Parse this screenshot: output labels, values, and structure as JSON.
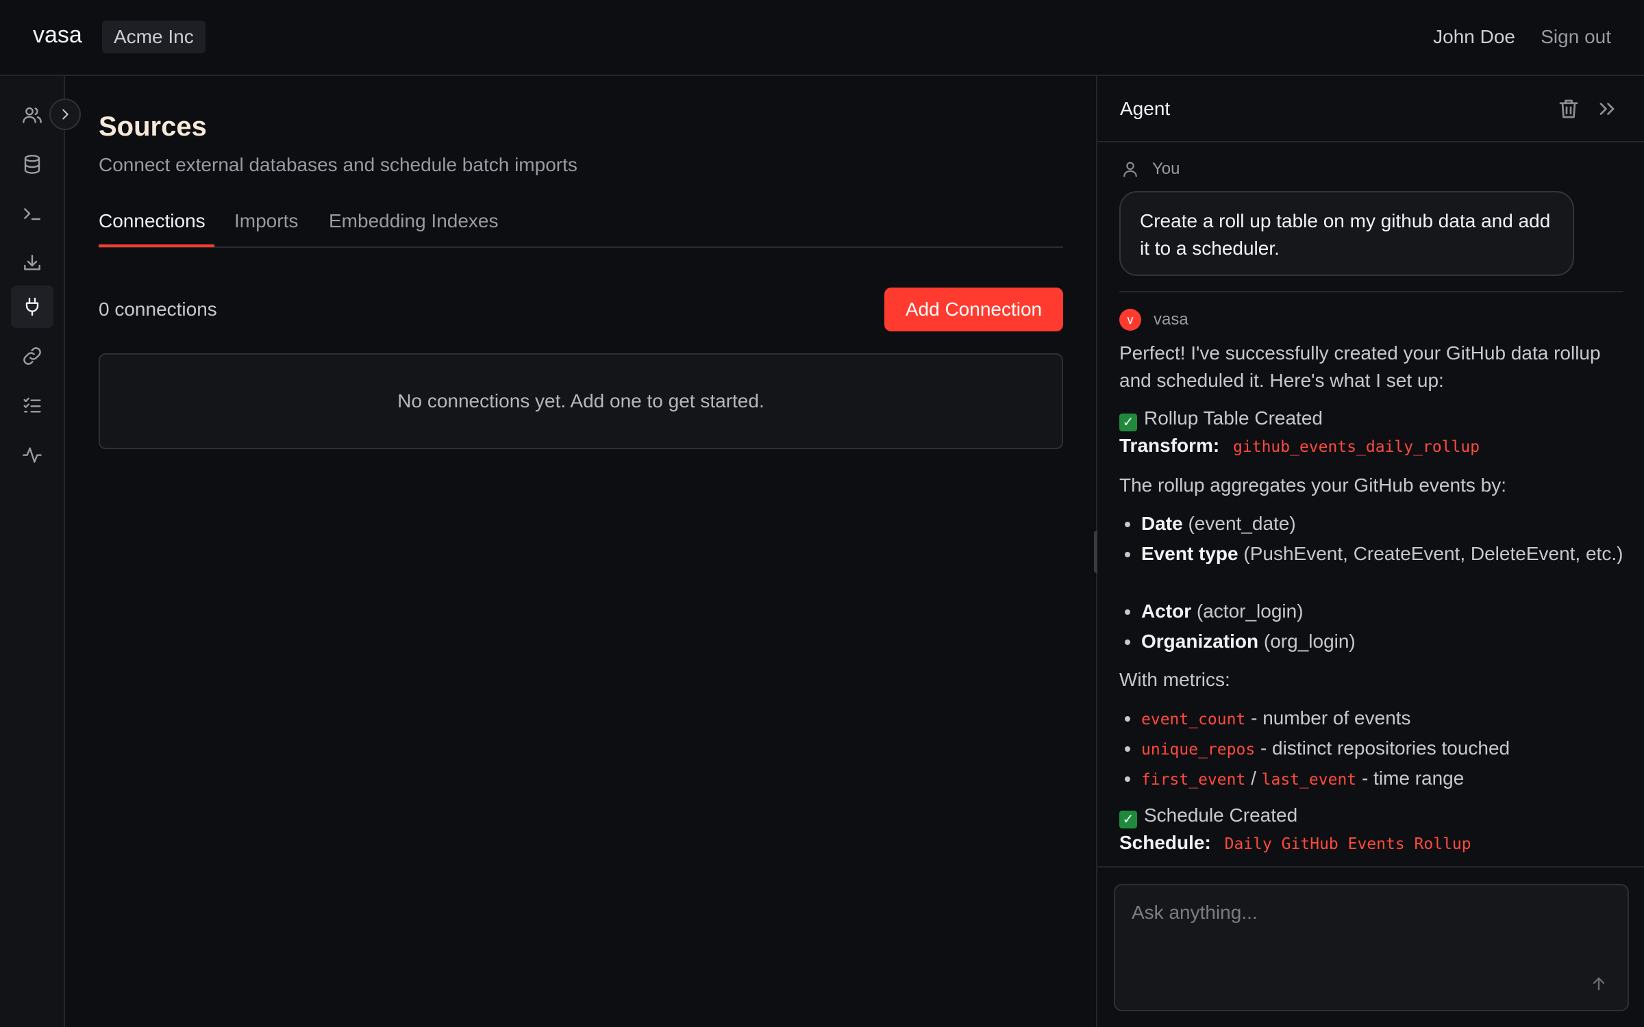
{
  "header": {
    "brand": "vasa",
    "org": "Acme Inc",
    "user_name": "John Doe",
    "sign_out": "Sign out"
  },
  "rail": {
    "items": [
      {
        "icon": "users-icon"
      },
      {
        "icon": "database-icon"
      },
      {
        "icon": "terminal-icon"
      },
      {
        "icon": "download-icon"
      },
      {
        "icon": "plug-icon",
        "active": true
      },
      {
        "icon": "link-icon"
      },
      {
        "icon": "checklist-icon"
      },
      {
        "icon": "activity-icon"
      }
    ]
  },
  "main": {
    "title": "Sources",
    "subtitle": "Connect external databases and schedule batch imports",
    "tabs": [
      {
        "label": "Connections",
        "active": true
      },
      {
        "label": "Imports"
      },
      {
        "label": "Embedding Indexes"
      }
    ],
    "connection_count": "0 connections",
    "add_connection": "Add Connection",
    "empty_state": "No connections yet. Add one to get started."
  },
  "agent": {
    "title": "Agent",
    "user_author": "You",
    "user_message": "Create a roll up table on my github data and add it to a scheduler.",
    "bot_author": "vasa",
    "bot_avatar_letter": "v",
    "response": {
      "intro": "Perfect! I've successfully created your GitHub data rollup and scheduled it. Here's what I set up:",
      "check_mark": "✓",
      "rollup_heading": "Rollup Table Created",
      "transform_label": "Transform:",
      "transform_value": "github_events_daily_rollup",
      "aggregates_intro": "The rollup aggregates your GitHub events by:",
      "dimensions": [
        {
          "name": "Date",
          "detail": "(event_date)"
        },
        {
          "name": "Event type",
          "detail": "(PushEvent, CreateEvent, DeleteEvent, etc.)"
        },
        {
          "name": "Actor",
          "detail": "(actor_login)"
        },
        {
          "name": "Organization",
          "detail": "(org_login)"
        }
      ],
      "metrics_intro": "With metrics:",
      "metrics": [
        {
          "code": "event_count",
          "desc": "- number of events"
        },
        {
          "code": "unique_repos",
          "desc": "- distinct repositories touched"
        },
        {
          "code": "first_event",
          "sep": "/",
          "code2": "last_event",
          "desc": "- time range"
        }
      ],
      "schedule_heading": "Schedule Created",
      "schedule_label": "Schedule:",
      "schedule_value": "Daily GitHub Events Rollup"
    },
    "composer_placeholder": "Ask anything..."
  },
  "colors": {
    "accent": "#ff3b2f",
    "background": "#0d0e12",
    "success": "#1f8a3c"
  }
}
